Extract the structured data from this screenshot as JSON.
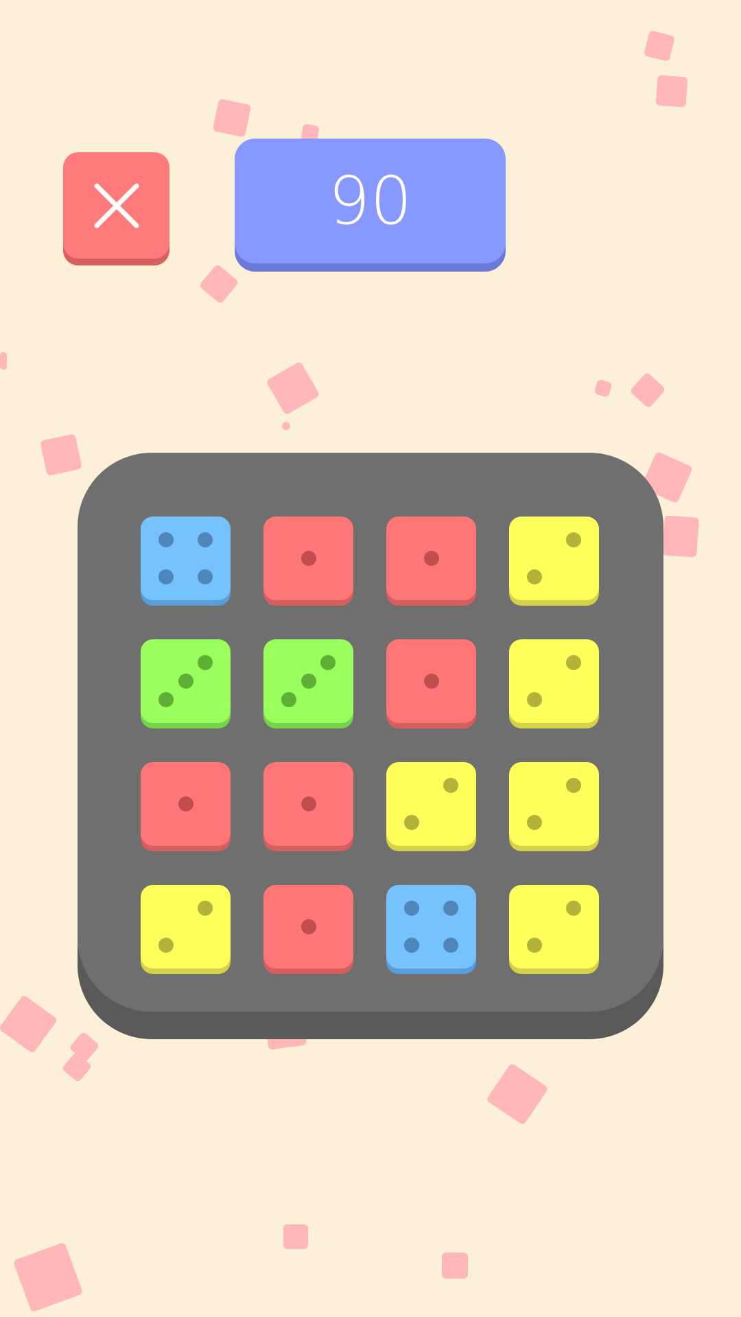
{
  "score": {
    "value": "90"
  },
  "close_button": {
    "icon": "close-icon",
    "color": "#ff7b7b"
  },
  "colors": {
    "background": "#fdf0d8",
    "board": "#706f6f",
    "score_box": "#8798ff",
    "blue": "#75c2ff",
    "red": "#ff7676",
    "yellow": "#ffff5c",
    "green": "#99ff5c"
  },
  "board": {
    "rows": [
      [
        {
          "color": "blue",
          "pips": 4
        },
        {
          "color": "red",
          "pips": 1
        },
        {
          "color": "red",
          "pips": 1
        },
        {
          "color": "yellow",
          "pips": 2
        }
      ],
      [
        {
          "color": "green",
          "pips": 3
        },
        {
          "color": "green",
          "pips": 3
        },
        {
          "color": "red",
          "pips": 1
        },
        {
          "color": "yellow",
          "pips": 2
        }
      ],
      [
        {
          "color": "red",
          "pips": 1
        },
        {
          "color": "red",
          "pips": 1
        },
        {
          "color": "yellow",
          "pips": 2
        },
        {
          "color": "yellow",
          "pips": 2
        }
      ],
      [
        {
          "color": "yellow",
          "pips": 2
        },
        {
          "color": "red",
          "pips": 1
        },
        {
          "color": "blue",
          "pips": 4
        },
        {
          "color": "yellow",
          "pips": 2
        }
      ]
    ]
  }
}
